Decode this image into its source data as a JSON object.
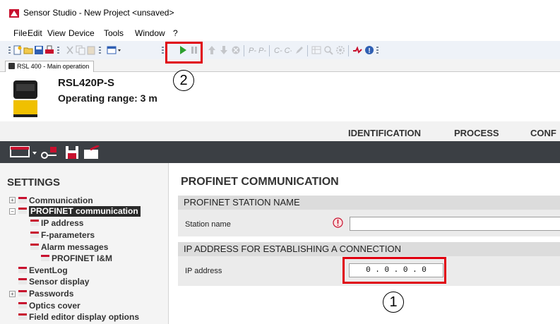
{
  "window": {
    "title": "Sensor Studio - New Project  <unsaved>"
  },
  "menu": [
    {
      "label": "File"
    },
    {
      "label": "Edit"
    },
    {
      "label": "View"
    },
    {
      "label": "Device"
    },
    {
      "label": "Tools"
    },
    {
      "label": "Window"
    },
    {
      "label": "?"
    }
  ],
  "toolbar": {
    "icons": [
      "new-project-icon",
      "open-icon",
      "save-icon",
      "print-icon",
      "cut-icon",
      "copy-icon",
      "paste-icon",
      "view-icon",
      "run-icon",
      "pause-icon",
      "upload-icon",
      "download-icon",
      "stop-icon",
      "parameter-icon",
      "compare-icon",
      "settings-icon",
      "help-icon"
    ],
    "highlight_color": "#e0000f"
  },
  "device_tab": {
    "label": "RSL 400 - Main operation"
  },
  "device": {
    "name": "RSL420P-S",
    "operating_range": "Operating range: 3 m"
  },
  "nav_tabs": [
    {
      "label": "IDENTIFICATION"
    },
    {
      "label": "PROCESS"
    },
    {
      "label": "CONF"
    }
  ],
  "settings": {
    "title": "SETTINGS",
    "items": [
      {
        "label": "Communication"
      },
      {
        "label": "PROFINET communication"
      },
      {
        "label": "IP address"
      },
      {
        "label": "F-parameters"
      },
      {
        "label": "Alarm messages"
      },
      {
        "label": "PROFINET I&M"
      },
      {
        "label": "EventLog"
      },
      {
        "label": "Sensor display"
      },
      {
        "label": "Passwords"
      },
      {
        "label": "Optics cover"
      },
      {
        "label": "Field editor display options"
      }
    ]
  },
  "main": {
    "title": "PROFINET COMMUNICATION",
    "station_group": {
      "header": "PROFINET STATION NAME",
      "label": "Station name",
      "value": ""
    },
    "ip_group": {
      "header": "IP ADDRESS FOR ESTABLISHING A CONNECTION",
      "label": "IP address",
      "value": "0 . 0 . 0 . 0"
    }
  },
  "callouts": {
    "one": "1",
    "two": "2"
  },
  "colors": {
    "accent_red": "#c8102e",
    "dark_bar": "#3b3f44"
  }
}
